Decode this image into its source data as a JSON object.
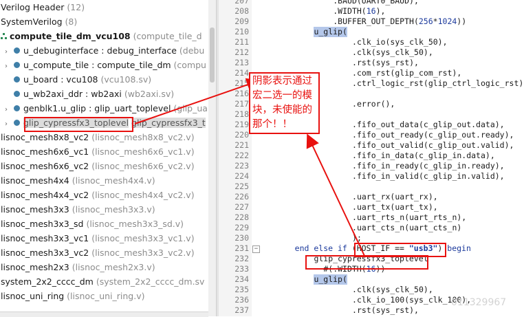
{
  "tree": {
    "rows": [
      {
        "icon": "none",
        "chev": "",
        "main": "Verilog Header",
        "file": "(12)",
        "indent": 0,
        "bold": false
      },
      {
        "icon": "none",
        "chev": "",
        "main": "SystemVerilog",
        "file": "(8)",
        "indent": 0,
        "bold": false
      },
      {
        "icon": "hierarchy",
        "chev": "",
        "main": "compute_tile_dm_vcu108",
        "file": "(compute_tile_d",
        "indent": 0,
        "bold": true
      },
      {
        "icon": "dot",
        "chev": "›",
        "main": "u_debuginterface : debug_interface",
        "file": "(debu",
        "indent": 1,
        "bold": false
      },
      {
        "icon": "dot",
        "chev": "›",
        "main": "u_compute_tile : compute_tile_dm",
        "file": "(compu",
        "indent": 1,
        "bold": false
      },
      {
        "icon": "dot",
        "chev": "",
        "main": "u_board : vcu108",
        "file": "(vcu108.sv)",
        "indent": 1,
        "bold": false
      },
      {
        "icon": "dot",
        "chev": "",
        "main": "u_wb2axi_ddr : wb2axi",
        "file": "(wb2axi.sv)",
        "indent": 1,
        "bold": false
      },
      {
        "icon": "dot",
        "chev": "›",
        "main": "genblk1.u_glip : glip_uart_toplevel",
        "file": "(glip_ua",
        "indent": 1,
        "bold": false
      },
      {
        "icon": "dot",
        "chev": "›",
        "main": "glip_cypressfx3_toplevel",
        "file": "glip_cypressfx3_t",
        "indent": 1,
        "bold": false,
        "greyed": true
      },
      {
        "icon": "none",
        "chev": "",
        "main": "lisnoc_mesh8x8_vc2",
        "file": "(lisnoc_mesh8x8_vc2.v)",
        "indent": 0,
        "bold": false
      },
      {
        "icon": "none",
        "chev": "",
        "main": "lisnoc_mesh6x6_vc1",
        "file": "(lisnoc_mesh6x6_vc1.v)",
        "indent": 0,
        "bold": false
      },
      {
        "icon": "none",
        "chev": "",
        "main": "lisnoc_mesh6x6_vc2",
        "file": "(lisnoc_mesh6x6_vc2.v)",
        "indent": 0,
        "bold": false
      },
      {
        "icon": "none",
        "chev": "",
        "main": "lisnoc_mesh4x4",
        "file": "(lisnoc_mesh4x4.v)",
        "indent": 0,
        "bold": false
      },
      {
        "icon": "none",
        "chev": "",
        "main": "lisnoc_mesh4x4_vc2",
        "file": "(lisnoc_mesh4x4_vc2.v)",
        "indent": 0,
        "bold": false
      },
      {
        "icon": "none",
        "chev": "",
        "main": "lisnoc_mesh3x3",
        "file": "(lisnoc_mesh3x3.v)",
        "indent": 0,
        "bold": false
      },
      {
        "icon": "none",
        "chev": "",
        "main": "lisnoc_mesh3x3_sd",
        "file": "(lisnoc_mesh3x3_sd.v)",
        "indent": 0,
        "bold": false
      },
      {
        "icon": "none",
        "chev": "",
        "main": "lisnoc_mesh3x3_vc1",
        "file": "(lisnoc_mesh3x3_vc1.v)",
        "indent": 0,
        "bold": false
      },
      {
        "icon": "none",
        "chev": "",
        "main": "lisnoc_mesh3x3_vc2",
        "file": "(lisnoc_mesh3x3_vc2.v)",
        "indent": 0,
        "bold": false
      },
      {
        "icon": "none",
        "chev": "",
        "main": "lisnoc_mesh2x3",
        "file": "(lisnoc_mesh2x3.v)",
        "indent": 0,
        "bold": false
      },
      {
        "icon": "none",
        "chev": "",
        "main": "system_2x2_cccc_dm",
        "file": "(system_2x2_cccc_dm.sv",
        "indent": 0,
        "bold": false
      },
      {
        "icon": "none",
        "chev": "",
        "main": "lisnoc_uni_ring",
        "file": "(lisnoc_uni_ring.v)",
        "indent": 0,
        "bold": false
      }
    ]
  },
  "editor": {
    "lines": [
      {
        "n": "207",
        "indent": 15,
        "t": ".BAUD(UART0_BAUD),"
      },
      {
        "n": "208",
        "indent": 15,
        "t": ".WIDTH(16),"
      },
      {
        "n": "209",
        "indent": 15,
        "t": ".BUFFER_OUT_DEPTH(256*1024))"
      },
      {
        "n": "210",
        "indent": 11,
        "t": "u_glip(",
        "hl": "u_glip"
      },
      {
        "n": "211",
        "indent": 19,
        "t": ".clk_io(sys_clk_50),"
      },
      {
        "n": "212",
        "indent": 19,
        "t": ".clk(sys_clk_50),"
      },
      {
        "n": "213",
        "indent": 19,
        "t": ".rst(sys_rst),"
      },
      {
        "n": "214",
        "indent": 19,
        "t": ".com_rst(glip_com_rst),"
      },
      {
        "n": "215",
        "indent": 19,
        "t": ".ctrl_logic_rst(glip_ctrl_logic_rst),"
      },
      {
        "n": "216",
        "indent": 19,
        "t": ""
      },
      {
        "n": "217",
        "indent": 19,
        "t": ".error(),"
      },
      {
        "n": "218",
        "indent": 19,
        "t": ""
      },
      {
        "n": "219",
        "indent": 19,
        "t": ".fifo_out_data(c_glip_out.data),"
      },
      {
        "n": "220",
        "indent": 19,
        "t": ".fifo_out_ready(c_glip_out.ready),"
      },
      {
        "n": "221",
        "indent": 19,
        "t": ".fifo_out_valid(c_glip_out.valid),"
      },
      {
        "n": "222",
        "indent": 19,
        "t": ".fifo_in_data(c_glip_in.data),"
      },
      {
        "n": "223",
        "indent": 19,
        "t": ".fifo_in_ready(c_glip_in.ready),"
      },
      {
        "n": "224",
        "indent": 19,
        "t": ".fifo_in_valid(c_glip_in.valid),"
      },
      {
        "n": "225",
        "indent": 19,
        "t": ""
      },
      {
        "n": "226",
        "indent": 19,
        "t": ".uart_rx(uart_rx),"
      },
      {
        "n": "227",
        "indent": 19,
        "t": ".uart_tx(uart_tx),"
      },
      {
        "n": "228",
        "indent": 19,
        "t": ".uart_rts_n(uart_rts_n),"
      },
      {
        "n": "229",
        "indent": 19,
        "t": ".uart_cts_n(uart_cts_n)"
      },
      {
        "n": "230",
        "indent": 19,
        "t": ");"
      },
      {
        "n": "231",
        "indent": 7,
        "t": "end else if (HOST_IF == \"usb3\") begin",
        "fold": true
      },
      {
        "n": "232",
        "indent": 11,
        "t": "glip_cypressfx3_toplevel"
      },
      {
        "n": "233",
        "indent": 13,
        "t": "#(.WIDTH(16))"
      },
      {
        "n": "234",
        "indent": 11,
        "t": "u_glip(",
        "hl": "u_glip"
      },
      {
        "n": "235",
        "indent": 19,
        "t": ".clk(sys_clk_50),"
      },
      {
        "n": "236",
        "indent": 19,
        "t": ".clk_io_100(sys_clk_100),"
      },
      {
        "n": "237",
        "indent": 19,
        "t": ".rst(sys_rst),"
      }
    ]
  },
  "annotation": {
    "callout_text": "阴影表示通过宏二选一的模块，未使能的那个！！"
  },
  "watermark": "011329967",
  "colors": {
    "annotation_red": "#e8110f",
    "keyword_blue": "#1c3a9c",
    "selection_highlight": "#b4c7ea",
    "tree_dot": "#3f7fa8"
  }
}
